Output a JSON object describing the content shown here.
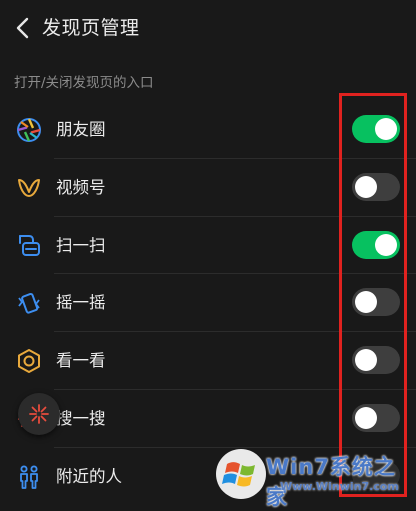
{
  "header": {
    "title": "发现页管理"
  },
  "section_label": "打开/关闭发现页的入口",
  "items": [
    {
      "label": "朋友圈",
      "icon": "moments-aperture-icon",
      "enabled": true
    },
    {
      "label": "视频号",
      "icon": "channels-butterfly-icon",
      "enabled": false
    },
    {
      "label": "扫一扫",
      "icon": "scan-icon",
      "enabled": true
    },
    {
      "label": "摇一摇",
      "icon": "shake-phone-icon",
      "enabled": false
    },
    {
      "label": "看一看",
      "icon": "top-stories-icon",
      "enabled": false
    },
    {
      "label": "搜一搜",
      "icon": "search-star-icon",
      "enabled": false
    },
    {
      "label": "附近的人",
      "icon": "people-nearby-icon",
      "enabled": false
    }
  ],
  "watermark": {
    "brand": "Win7系统之家",
    "url": "Www.Winwin7.com"
  },
  "colors": {
    "background": "#191919",
    "toggle_on": "#07c160",
    "toggle_off": "#3e3e3e",
    "highlight_border": "#e0221f",
    "icon_blue": "#3d8ef0",
    "icon_gold": "#e8a93c"
  }
}
